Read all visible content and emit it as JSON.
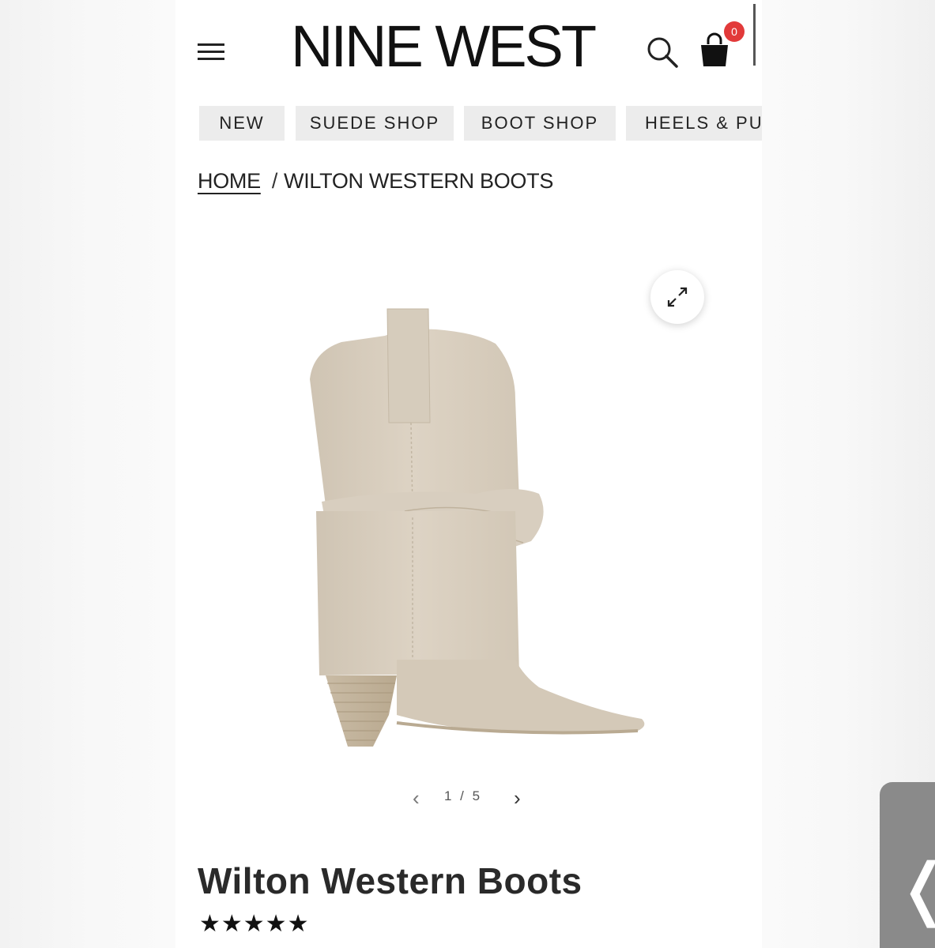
{
  "header": {
    "brand": "NINE WEST",
    "cart_count": "0"
  },
  "nav": {
    "tabs": [
      {
        "label": "NEW"
      },
      {
        "label": "SUEDE SHOP"
      },
      {
        "label": "BOOT SHOP"
      },
      {
        "label": "HEELS & PUMPS"
      }
    ]
  },
  "breadcrumb": {
    "home": "HOME",
    "separator": "/",
    "current": "WILTON WESTERN BOOTS"
  },
  "gallery": {
    "prev": "‹",
    "counter": "1 / 5",
    "next": "›"
  },
  "product": {
    "title": "Wilton Western Boots",
    "rating_stars": "★★★★★",
    "rating_value": 5,
    "color": "#d9cfc0"
  },
  "side_handle": {
    "label": "❬"
  },
  "icons": [
    "menu-icon",
    "search-icon",
    "shopping-bag-icon",
    "expand-icon",
    "chevron-left-icon",
    "chevron-right-icon"
  ]
}
